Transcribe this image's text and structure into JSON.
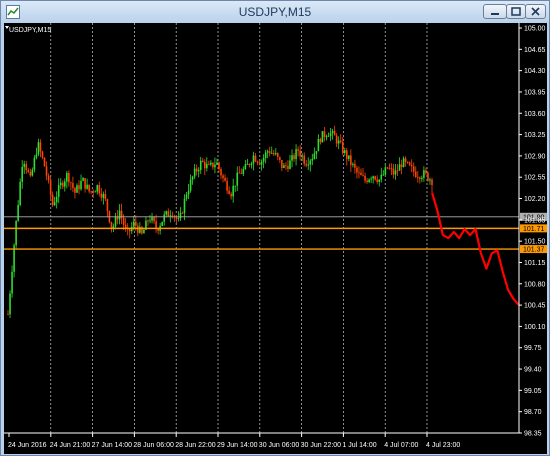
{
  "window": {
    "title": "USDJPY,M15",
    "chart_label": "USDJPY,M15",
    "colors": {
      "background": "#000000",
      "bull": "#2ee02e",
      "bear": "#ff4500",
      "level": "#ff9900",
      "projection": "#ff0000",
      "grid": "#ffffff"
    }
  },
  "chart_data": {
    "type": "candlestick",
    "symbol": "USDJPY",
    "timeframe": "M15",
    "ylim": [
      98.35,
      105.0
    ],
    "y_ticks": [
      "105.00",
      "104.65",
      "104.30",
      "103.95",
      "103.60",
      "103.25",
      "102.90",
      "102.55",
      "102.20",
      "101.85",
      "101.50",
      "101.15",
      "100.80",
      "100.45",
      "100.10",
      "99.75",
      "99.40",
      "99.05",
      "98.70",
      "98.35"
    ],
    "x_ticks": [
      "24 Jun 2016",
      "24 Jun 21:00",
      "27 Jun 14:00",
      "28 Jun 06:00",
      "28 Jun 22:00",
      "29 Jun 14:00",
      "30 Jun 06:00",
      "30 Jun 22:00",
      "1 Jul 14:00",
      "4 Jul 07:00",
      "4 Jul 23:00"
    ],
    "grid": "vertical dashed",
    "price_path": [
      [
        0,
        100.3
      ],
      [
        1,
        101.7
      ],
      [
        2,
        102.9
      ],
      [
        3,
        102.5
      ],
      [
        4,
        103.1
      ],
      [
        5,
        102.7
      ],
      [
        6,
        102.1
      ],
      [
        7,
        102.4
      ],
      [
        8,
        102.6
      ],
      [
        9,
        102.3
      ],
      [
        10,
        102.5
      ],
      [
        11,
        102.3
      ],
      [
        12,
        102.4
      ],
      [
        13,
        102.2
      ],
      [
        14,
        101.7
      ],
      [
        15,
        102.0
      ],
      [
        16,
        101.6
      ],
      [
        17,
        101.8
      ],
      [
        18,
        101.6
      ],
      [
        19,
        101.9
      ],
      [
        20,
        101.7
      ],
      [
        21,
        101.9
      ],
      [
        22,
        102.0
      ],
      [
        23,
        101.8
      ],
      [
        24,
        102.3
      ],
      [
        25,
        102.6
      ],
      [
        26,
        102.8
      ],
      [
        27,
        102.7
      ],
      [
        28,
        102.8
      ],
      [
        29,
        102.5
      ],
      [
        30,
        102.3
      ],
      [
        31,
        102.6
      ],
      [
        32,
        102.7
      ],
      [
        33,
        102.9
      ],
      [
        34,
        102.8
      ],
      [
        35,
        103.0
      ],
      [
        36,
        102.9
      ],
      [
        37,
        102.7
      ],
      [
        38,
        102.8
      ],
      [
        39,
        103.0
      ],
      [
        40,
        102.8
      ],
      [
        41,
        102.9
      ],
      [
        42,
        103.2
      ],
      [
        43,
        103.3
      ],
      [
        44,
        103.2
      ],
      [
        45,
        103.0
      ],
      [
        46,
        102.8
      ],
      [
        47,
        102.6
      ],
      [
        48,
        102.5
      ],
      [
        49,
        102.6
      ],
      [
        50,
        102.5
      ],
      [
        51,
        102.7
      ],
      [
        52,
        102.6
      ],
      [
        53,
        102.8
      ],
      [
        54,
        102.7
      ],
      [
        55,
        102.6
      ],
      [
        56,
        102.6
      ],
      [
        57,
        102.5
      ]
    ],
    "horizontal_levels": [
      {
        "label": "101.90",
        "value": 101.9,
        "color": "#b0b0b0",
        "text_color": "#000000"
      },
      {
        "label": "101.71",
        "value": 101.71,
        "color": "#ff9900",
        "text_color": "#000000"
      },
      {
        "label": "101.37",
        "value": 101.37,
        "color": "#ff9900",
        "text_color": "#000000"
      }
    ],
    "projection_path": [
      [
        0,
        102.3
      ],
      [
        1,
        102.0
      ],
      [
        2,
        101.6
      ],
      [
        3,
        101.55
      ],
      [
        4,
        101.65
      ],
      [
        5,
        101.55
      ],
      [
        6,
        101.7
      ],
      [
        7,
        101.6
      ],
      [
        8,
        101.7
      ],
      [
        9,
        101.3
      ],
      [
        10,
        101.05
      ],
      [
        11,
        101.3
      ],
      [
        12,
        101.35
      ],
      [
        13,
        101.0
      ],
      [
        14,
        100.7
      ],
      [
        15,
        100.55
      ],
      [
        16,
        100.45
      ]
    ]
  }
}
